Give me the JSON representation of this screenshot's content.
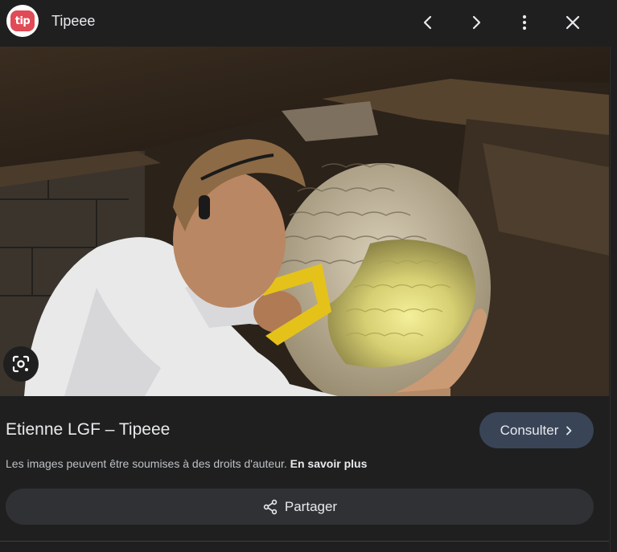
{
  "header": {
    "logo_text": "tip",
    "site_name": "Tipeee",
    "icons": [
      "chevron-left-icon",
      "chevron-right-icon",
      "more-vert-icon",
      "close-icon"
    ]
  },
  "image": {
    "lens_icon": "google-lens-icon"
  },
  "result": {
    "title": "Etienne LGF – Tipeee",
    "consult_label": "Consulter",
    "copyright_text": "Les images peuvent être soumises à des droits d'auteur.",
    "learn_more": "En savoir plus",
    "share_label": "Partager"
  },
  "colors": {
    "background": "#1f1f1f",
    "consult_button": "#394457",
    "share_button": "#303134",
    "logo_red": "#e04b56"
  }
}
